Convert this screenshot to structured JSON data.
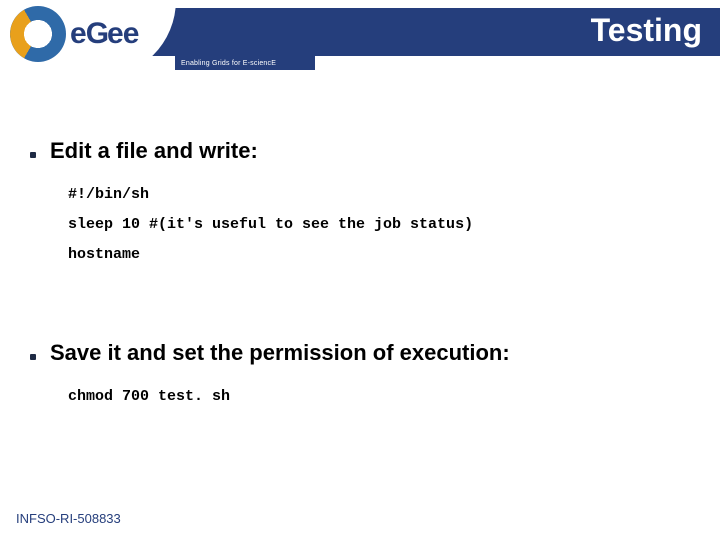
{
  "header": {
    "title": "Testing",
    "subtitle": "Enabling Grids for E-sciencE"
  },
  "logo": {
    "letters": "eGee"
  },
  "content": {
    "bullets": [
      {
        "text": "Edit a file and write:",
        "code": "#!/bin/sh\nsleep 10 #(it's useful to see the job status)\nhostname"
      },
      {
        "text": "Save it and set the permission of execution:",
        "code": "chmod 700 test. sh"
      }
    ]
  },
  "footer": {
    "ref": "INFSO-RI-508833"
  }
}
